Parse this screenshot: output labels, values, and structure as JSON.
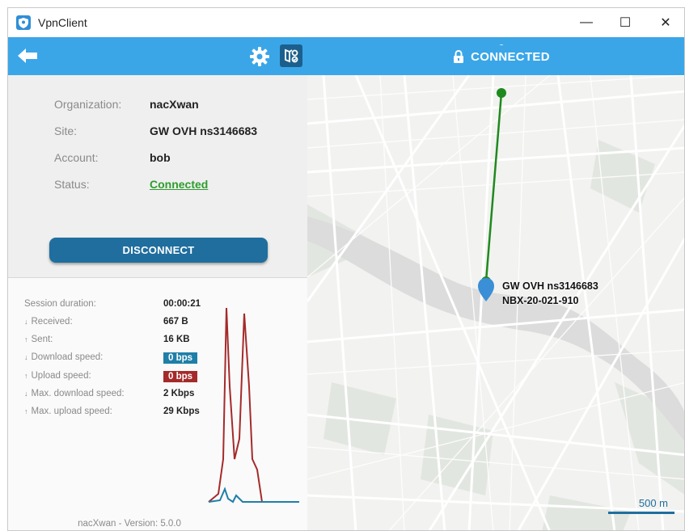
{
  "window": {
    "title": "VpnClient",
    "minimize_glyph": "—",
    "maximize_glyph": "☐",
    "close_glyph": "✕"
  },
  "toolbar": {
    "back_icon": "arrow-left-icon",
    "settings_icon": "gear-icon",
    "map_mode_icon": "map-pin-icon",
    "shield_icon": "shield-user-icon",
    "connection_status": "CONNECTED",
    "accent_color": "#3aa6e8"
  },
  "info": {
    "organization_label": "Organization:",
    "organization_value": "nacXwan",
    "site_label": "Site:",
    "site_value": "GW OVH ns3146683",
    "account_label": "Account:",
    "account_value": "bob",
    "status_label": "Status:",
    "status_value": "Connected",
    "status_color": "#2e9d2e"
  },
  "disconnect_label": "DISCONNECT",
  "stats": {
    "session_duration_label": "Session duration:",
    "session_duration_value": "00:00:21",
    "received_label": "Received:",
    "received_value": "667 B",
    "sent_label": "Sent:",
    "sent_value": "16 KB",
    "download_speed_label": "Download speed:",
    "download_speed_value": "0 bps",
    "download_color": "#1f7fa8",
    "upload_speed_label": "Upload speed:",
    "upload_speed_value": "0 bps",
    "upload_color": "#a52a2a",
    "max_download_label": "Max. download speed:",
    "max_download_value": "2 Kbps",
    "max_upload_label": "Max. upload speed:",
    "max_upload_value": "29 Kbps",
    "down_arrow": "↓",
    "up_arrow": "↑"
  },
  "footer": "nacXwan - Version: 5.0.0",
  "map": {
    "gateway_name": "GW OVH ns3146683",
    "gateway_id": "NBX-20-021-910",
    "scale_label": "500 m",
    "route_color": "#1e8a1e",
    "pin_color": "#3a8fd6"
  }
}
